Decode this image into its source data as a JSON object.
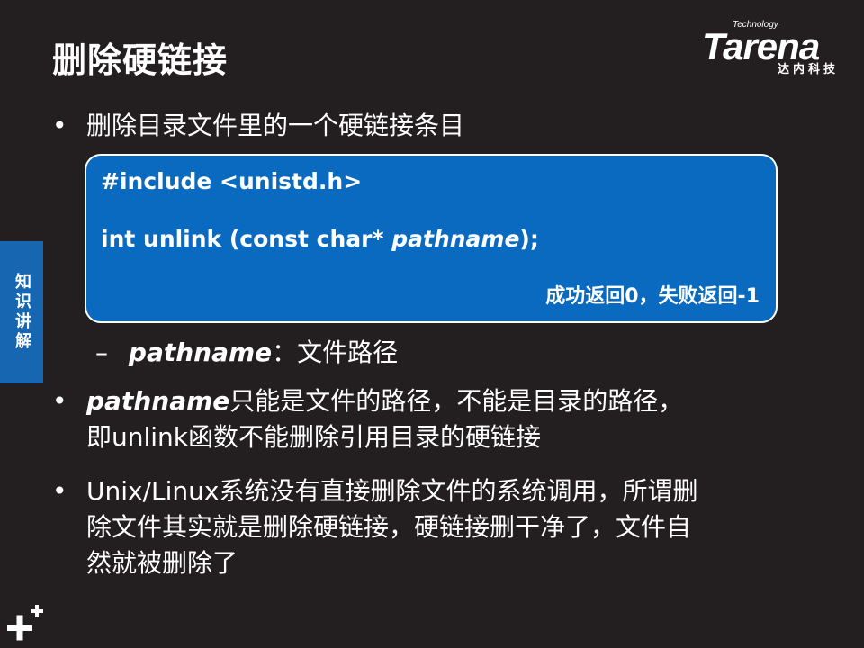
{
  "slide": {
    "title": "删除硬链接",
    "side_tab": "知识讲解"
  },
  "logo": {
    "technology": "Technology",
    "brand": "Tarena",
    "cn": "达内科技"
  },
  "bullets": {
    "b1": "删除目录文件里的一个硬链接条目",
    "b2_term": "pathname",
    "b2_line1": "只能是文件的路径，不能是目录的路径，",
    "b2_line2": "即unlink函数不能删除引用目录的硬链接",
    "b3_line1": "Unix/Linux系统没有直接删除文件的系统调用，所谓删",
    "b3_line2": "除文件其实就是删除硬链接，硬链接删干净了，文件自",
    "b3_line3": "然就被删除了",
    "marker": "•"
  },
  "code": {
    "include": "#include <unistd.h>",
    "sig_prefix": "int unlink (const char* ",
    "sig_param": "pathname",
    "sig_suffix": ");",
    "note": "成功返回0，失败返回-1"
  },
  "sub_item": {
    "dash": "–",
    "term": "pathname",
    "desc": "：文件路径"
  },
  "icons": {
    "plus": "plus-icon"
  }
}
